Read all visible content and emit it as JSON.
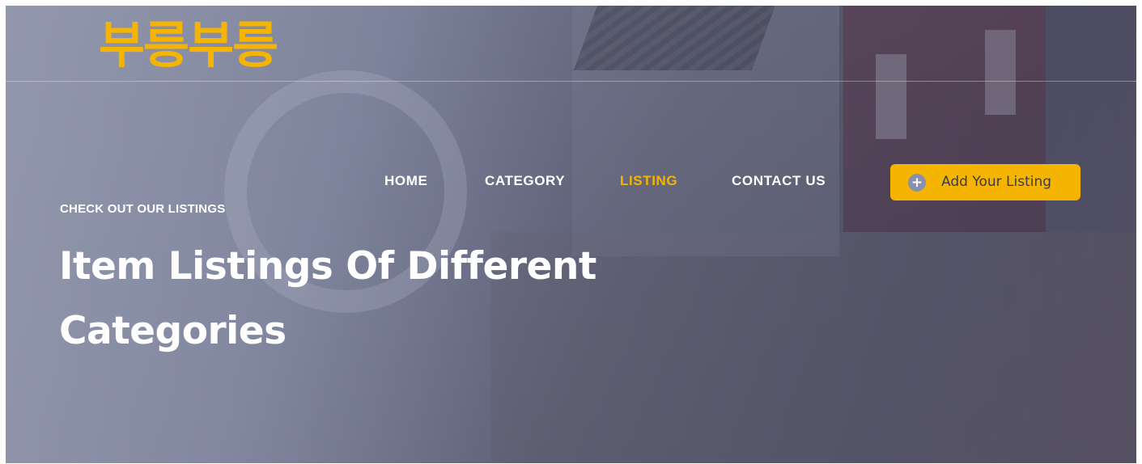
{
  "header": {
    "logo_text": "부릉부릉"
  },
  "nav": {
    "items": [
      {
        "label": "HOME",
        "active": false
      },
      {
        "label": "CATEGORY",
        "active": false
      },
      {
        "label": "LISTING",
        "active": true
      },
      {
        "label": "CONTACT US",
        "active": false
      }
    ],
    "cta": {
      "label": "Add Your Listing",
      "icon": "plus-circle-icon"
    }
  },
  "hero": {
    "kicker": "CHECK OUT OUR LISTINGS",
    "headline": "Item Listings Of Different Categories"
  },
  "colors": {
    "accent": "#f5b400",
    "text": "#ffffff",
    "button_text": "#3b3b4a"
  }
}
